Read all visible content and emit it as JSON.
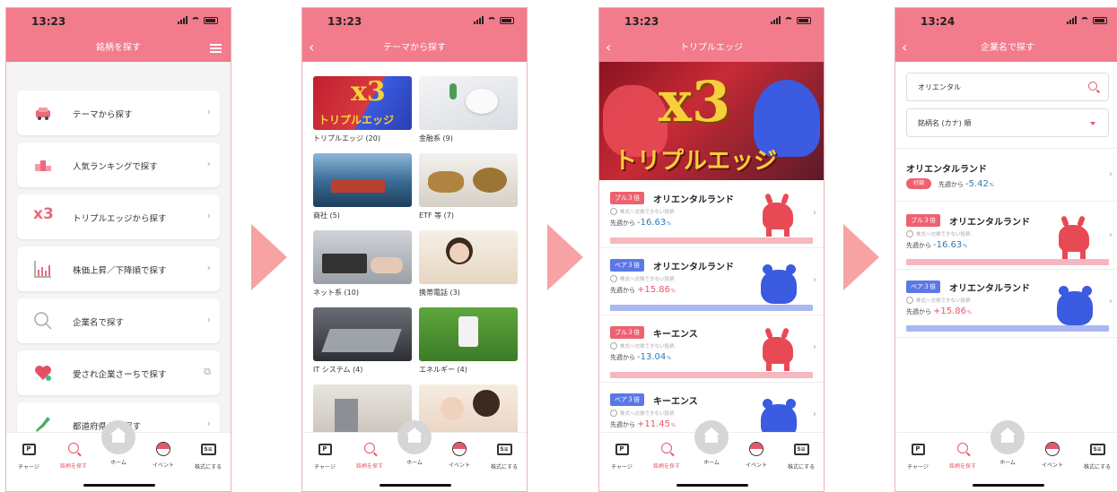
{
  "status": {
    "time1": "13:23",
    "time2": "13:23",
    "time3": "13:23",
    "time4": "13:24"
  },
  "colors": {
    "accent": "#f27c8c",
    "bull": "#ee6170",
    "bear": "#5b78e6",
    "negative": "#2d7bb6"
  },
  "tabbar": {
    "items": [
      {
        "label": "チャージ",
        "icon": "p-icon"
      },
      {
        "label": "銘柄を探す",
        "icon": "search-icon"
      },
      {
        "label": "ホーム",
        "icon": "home-icon"
      },
      {
        "label": "イベント",
        "icon": "ball-icon"
      },
      {
        "label": "株式にする",
        "icon": "stock-icon"
      }
    ],
    "p_glyph": "P",
    "s_glyph": "S≡"
  },
  "screen1": {
    "title": "銘柄を探す",
    "items": [
      {
        "label": "テーマから探す",
        "icon": "car-icon"
      },
      {
        "label": "人気ランキングで探す",
        "icon": "podium-icon"
      },
      {
        "label": "トリプルエッジから探す",
        "icon": "x3-icon"
      },
      {
        "label": "株価上昇／下降順で探す",
        "icon": "chart-icon"
      },
      {
        "label": "企業名で探す",
        "icon": "magnifier-icon"
      },
      {
        "label": "愛され企業さーちで探す",
        "icon": "heart-icon"
      },
      {
        "label": "都道府県から探す",
        "icon": "japan-map-icon"
      }
    ],
    "x3_glyph": "x3",
    "chevron": "›",
    "external_glyph": "⧉"
  },
  "screen2": {
    "title": "テーマから探す",
    "tiles": [
      {
        "caption": "トリプルエッジ (20)"
      },
      {
        "caption": "金融系 (9)"
      },
      {
        "caption": "商社 (5)"
      },
      {
        "caption": "ETF 等 (7)"
      },
      {
        "caption": "ネット系 (10)"
      },
      {
        "caption": "携帯電話 (3)"
      },
      {
        "caption": "IT システム (4)"
      },
      {
        "caption": "エネルギー (4)"
      },
      {
        "caption": ""
      },
      {
        "caption": ""
      }
    ],
    "tile_x3": "x3",
    "tile_word": "トリプルエッジ"
  },
  "screen3": {
    "title": "トリプルエッジ",
    "hero_x3": "x3",
    "hero_word": "トリプルエッジ",
    "cards": [
      {
        "badge": "ブル３倍",
        "type": "bull",
        "name": "オリエンタルランド",
        "warning": "株式へ交換できない銘柄",
        "prefix": "先週から",
        "change": "-16.63",
        "unit": "%"
      },
      {
        "badge": "ベア３倍",
        "type": "bear",
        "name": "オリエンタルランド",
        "warning": "株式へ交換できない銘柄",
        "prefix": "先週から",
        "change": "+15.86",
        "unit": "%"
      },
      {
        "badge": "ブル３倍",
        "type": "bull",
        "name": "キーエンス",
        "warning": "株式へ交換できない銘柄",
        "prefix": "先週から",
        "change": "-13.04",
        "unit": "%"
      },
      {
        "badge": "ベア３倍",
        "type": "bear",
        "name": "キーエンス",
        "warning": "株式へ交換できない銘柄",
        "prefix": "先週から",
        "change": "+11.45",
        "unit": "%"
      }
    ]
  },
  "screen4": {
    "title": "企業名で探す",
    "search_value": "オリエンタル",
    "sort_value": "銘柄名 (カナ) 順",
    "plain": {
      "name": "オリエンタルランド",
      "badge": "好調",
      "prefix": "先週から",
      "change": "-5.42",
      "unit": "%"
    },
    "cards": [
      {
        "badge": "ブル３倍",
        "type": "bull",
        "name": "オリエンタルランド",
        "warning": "株式へ交換できない銘柄",
        "prefix": "先週から",
        "change": "-16.63",
        "unit": "%"
      },
      {
        "badge": "ベア３倍",
        "type": "bear",
        "name": "オリエンタルランド",
        "warning": "株式へ交換できない銘柄",
        "prefix": "先週から",
        "change": "+15.86",
        "unit": "%"
      }
    ]
  }
}
